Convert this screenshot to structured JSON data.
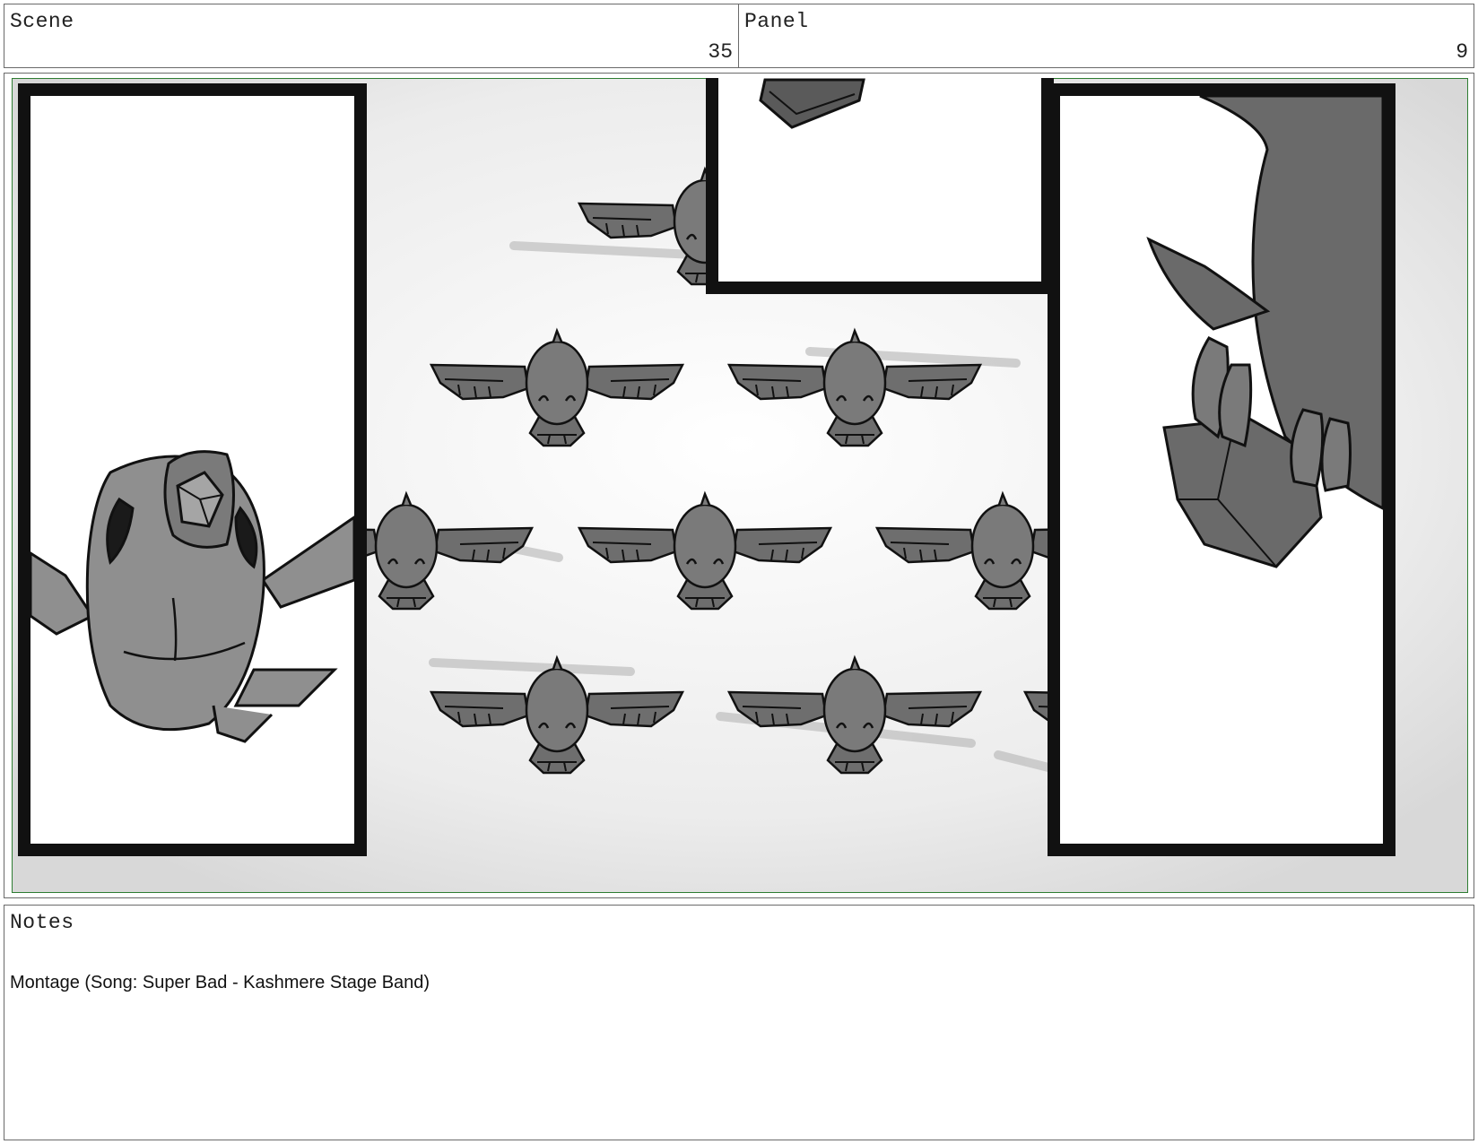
{
  "header": {
    "scene_label": "Scene",
    "scene_number": "35",
    "panel_label": "Panel",
    "panel_number": "9"
  },
  "frame": {
    "description_icon": "storyboard-drawing",
    "accent_color": "#2e7d32"
  },
  "notes": {
    "label": "Notes",
    "text": "Montage (Song: Super Bad - Kashmere Stage Band)"
  }
}
